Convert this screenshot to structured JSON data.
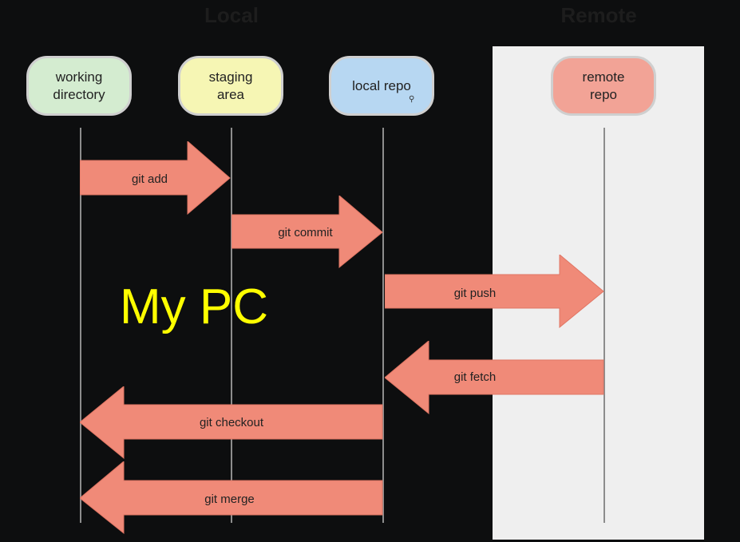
{
  "sections": {
    "local": "Local",
    "remote": "Remote"
  },
  "nodes": [
    {
      "id": "working-directory",
      "label": "working\ndirectory",
      "color": "#d4ecd0"
    },
    {
      "id": "staging-area",
      "label": "staging\narea",
      "color": "#f6f6b4"
    },
    {
      "id": "local-repo",
      "label": "local repo",
      "color": "#b7d7f2"
    },
    {
      "id": "remote-repo",
      "label": "remote\nrepo",
      "color": "#f2a396"
    }
  ],
  "commands": [
    {
      "id": "git-add",
      "label": "git add",
      "from": "working-directory",
      "to": "staging-area"
    },
    {
      "id": "git-commit",
      "label": "git commit",
      "from": "staging-area",
      "to": "local-repo"
    },
    {
      "id": "git-push",
      "label": "git push",
      "from": "local-repo",
      "to": "remote-repo"
    },
    {
      "id": "git-fetch",
      "label": "git fetch",
      "from": "remote-repo",
      "to": "local-repo"
    },
    {
      "id": "git-checkout",
      "label": "git checkout",
      "from": "local-repo",
      "to": "working-directory"
    },
    {
      "id": "git-merge",
      "label": "git merge",
      "from": "local-repo",
      "to": "working-directory"
    }
  ],
  "overlay": {
    "text": "My PC"
  },
  "colors": {
    "arrow": "#f08a78",
    "arrow_stroke": "#e07563",
    "overlay": "#ffff00"
  }
}
